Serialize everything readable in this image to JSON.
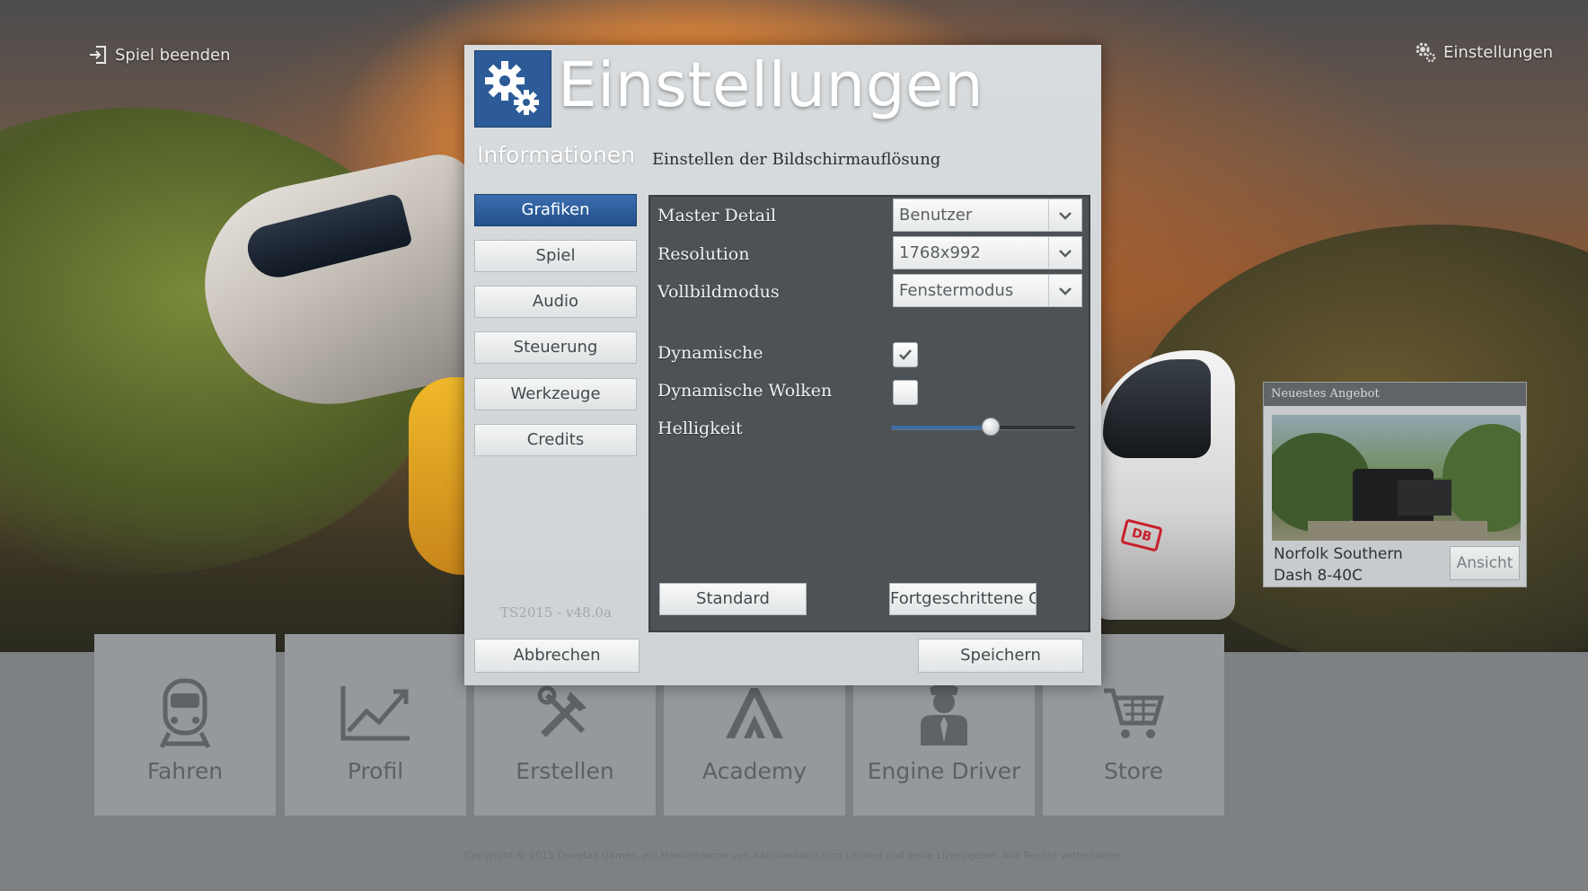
{
  "topbar": {
    "quit_label": "Spiel beenden",
    "settings_label": "Einstellungen"
  },
  "dialog": {
    "title": "Einstellungen",
    "subtitle": "Informationen",
    "description": "Einstellen der Bildschirmauflösung",
    "nav": [
      {
        "label": "Grafiken",
        "active": true
      },
      {
        "label": "Spiel",
        "active": false
      },
      {
        "label": "Audio",
        "active": false
      },
      {
        "label": "Steuerung",
        "active": false
      },
      {
        "label": "Werkzeuge",
        "active": false
      },
      {
        "label": "Credits",
        "active": false
      }
    ],
    "version": "TS2015 - v48.0a",
    "settings": {
      "master_detail": {
        "label": "Master Detail",
        "value": "Benutzer"
      },
      "resolution": {
        "label": "Resolution",
        "value": "1768x992"
      },
      "fullscreen": {
        "label": "Vollbildmodus",
        "value": "Fenstermodus"
      },
      "dynamic": {
        "label": "Dynamische",
        "checked": true
      },
      "dynamic_clouds": {
        "label": "Dynamische Wolken",
        "checked": false
      },
      "brightness": {
        "label": "Helligkeit",
        "level": 0.54
      }
    },
    "standard_label": "Standard",
    "advanced_label": "Fortgeschrittene Gra",
    "cancel_label": "Abbrechen",
    "save_label": "Speichern"
  },
  "offer": {
    "header": "Neuestes Angebot",
    "name_line1": "Norfolk Southern",
    "name_line2": "Dash 8-40C",
    "button_label": "Ansicht"
  },
  "tiles": [
    {
      "label": "Fahren",
      "icon": "train-icon"
    },
    {
      "label": "Profil",
      "icon": "chart-icon"
    },
    {
      "label": "Erstellen",
      "icon": "tools-icon"
    },
    {
      "label": "Academy",
      "icon": "academy-icon"
    },
    {
      "label": "Engine Driver",
      "icon": "driver-icon"
    },
    {
      "label": "Store",
      "icon": "cart-icon"
    }
  ],
  "copyright": "Copyright © 2015 Dovetail Games, ein Handelsname von RailSimulator.com Limited und seine Lizenzgeber. Alle Rechte vorbehalten.",
  "colors": {
    "accent_blue": "#2d5b97",
    "panel_dark": "#4c5256",
    "tile_bg": "#96999b"
  }
}
